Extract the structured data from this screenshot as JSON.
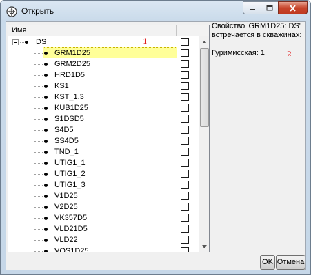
{
  "window": {
    "title": "Открыть"
  },
  "tree": {
    "column_name": "Имя",
    "root": {
      "label": "DS",
      "marker": "1"
    },
    "items": [
      {
        "label": "GRM1D25",
        "selected": true
      },
      {
        "label": "GRM2D25",
        "selected": false
      },
      {
        "label": "HRD1D5",
        "selected": false
      },
      {
        "label": "KS1",
        "selected": false
      },
      {
        "label": "KST_1.3",
        "selected": false
      },
      {
        "label": "KUB1D25",
        "selected": false
      },
      {
        "label": "S1DSD5",
        "selected": false
      },
      {
        "label": "S4D5",
        "selected": false
      },
      {
        "label": "SS4D5",
        "selected": false
      },
      {
        "label": "TND_1",
        "selected": false
      },
      {
        "label": "UTIG1_1",
        "selected": false
      },
      {
        "label": "UTIG1_2",
        "selected": false
      },
      {
        "label": "UTIG1_3",
        "selected": false
      },
      {
        "label": "V1D25",
        "selected": false
      },
      {
        "label": "V2D25",
        "selected": false
      },
      {
        "label": "VK357D5",
        "selected": false
      },
      {
        "label": "VLD21D5",
        "selected": false
      },
      {
        "label": "VLD22",
        "selected": false
      },
      {
        "label": "VOS1D25",
        "selected": false
      }
    ]
  },
  "info": {
    "description": "Свойство 'GRM1D25: DS' встречается в скважинах:",
    "result": "Гуримисская: 1",
    "marker": "2"
  },
  "buttons": {
    "ok": "OK",
    "cancel": "Отмена"
  }
}
